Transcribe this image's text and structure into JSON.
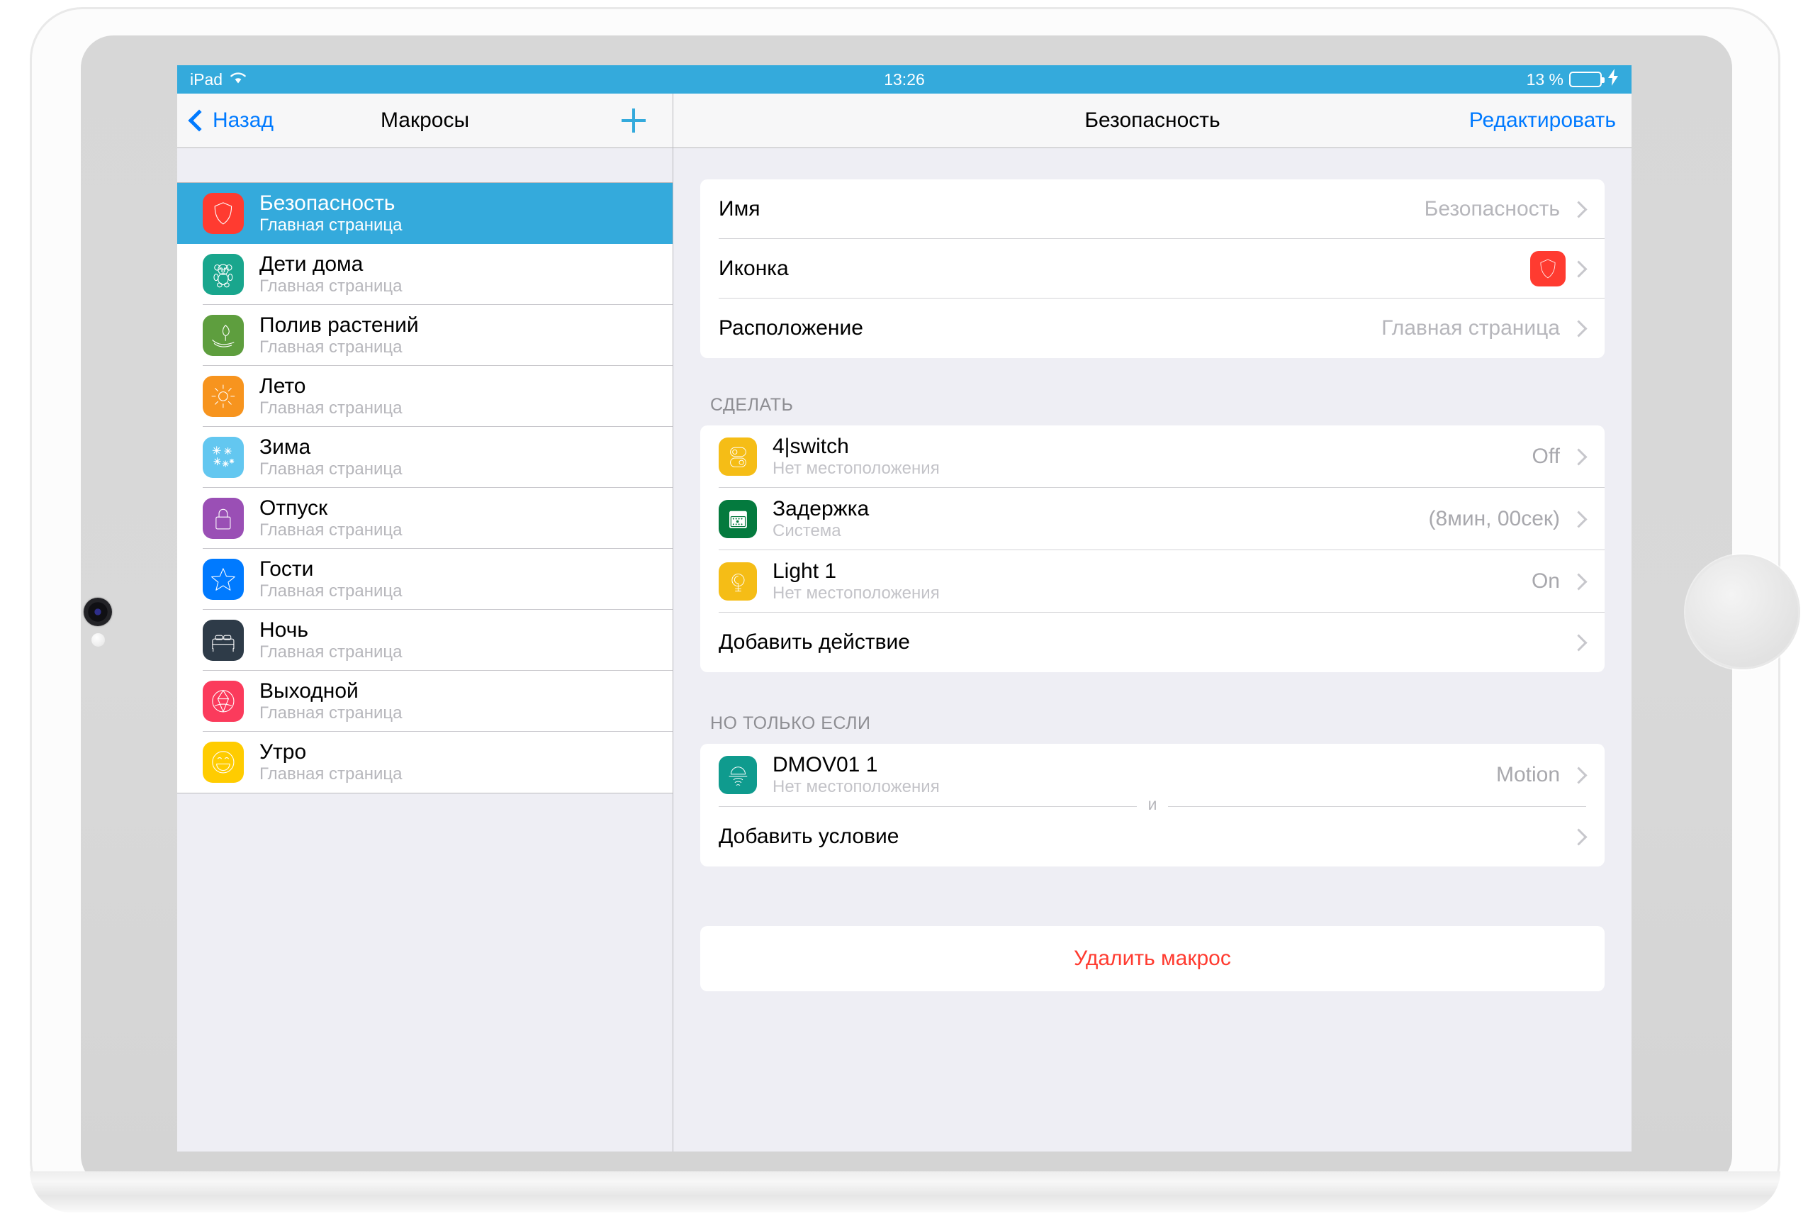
{
  "status_bar": {
    "device": "iPad",
    "wifi_icon": "wifi-icon",
    "time": "13:26",
    "battery_percent": "13 %",
    "charging_icon": "lightning-bolt-icon",
    "battery_level": 13
  },
  "left_nav": {
    "back_label": "Назад",
    "title": "Макросы",
    "add_icon": "plus-icon"
  },
  "right_nav": {
    "title": "Безопасность",
    "edit_label": "Редактировать"
  },
  "sidebar": {
    "items": [
      {
        "title": "Безопасность",
        "subtitle": "Главная страница",
        "icon": "shield-icon",
        "color": "#ff3b30",
        "selected": true
      },
      {
        "title": "Дети дома",
        "subtitle": "Главная страница",
        "icon": "teddy-bear-icon",
        "color": "#19a68d",
        "selected": false
      },
      {
        "title": "Полив растений",
        "subtitle": "Главная страница",
        "icon": "plant-watering-icon",
        "color": "#5e9e3e",
        "selected": false
      },
      {
        "title": "Лето",
        "subtitle": "Главная страница",
        "icon": "sun-icon",
        "color": "#f7941e",
        "selected": false
      },
      {
        "title": "Зима",
        "subtitle": "Главная страница",
        "icon": "snowflakes-icon",
        "color": "#63c7f0",
        "selected": false
      },
      {
        "title": "Отпуск",
        "subtitle": "Главная страница",
        "icon": "padlock-icon",
        "color": "#9a4fb5",
        "selected": false
      },
      {
        "title": "Гости",
        "subtitle": "Главная страница",
        "icon": "star-icon",
        "color": "#007aff",
        "selected": false
      },
      {
        "title": "Ночь",
        "subtitle": "Главная страница",
        "icon": "bed-icon",
        "color": "#2e3b48",
        "selected": false
      },
      {
        "title": "Выходной",
        "subtitle": "Главная страница",
        "icon": "balloon-icon",
        "color": "#fb3b5c",
        "selected": false
      },
      {
        "title": "Утро",
        "subtitle": "Главная страница",
        "icon": "smiley-face-icon",
        "color": "#ffcc00",
        "selected": false
      }
    ]
  },
  "detail": {
    "settings": [
      {
        "label": "Имя",
        "value": "Безопасность",
        "type": "text"
      },
      {
        "label": "Иконка",
        "value": "",
        "type": "icon",
        "icon": "shield-icon",
        "color": "#ff3b30"
      },
      {
        "label": "Расположение",
        "value": "Главная страница",
        "type": "text"
      }
    ],
    "actions_section": {
      "header": "СДЕЛАТЬ",
      "items": [
        {
          "title": "4|switch",
          "subtitle": "Нет местоположения",
          "value": "Off",
          "icon": "switch-toggle-icon",
          "color": "#f5bd16"
        },
        {
          "title": "Задержка",
          "subtitle": "Система",
          "value": "(8мин, 00сек)",
          "icon": "delay-keypad-icon",
          "color": "#047a3e"
        },
        {
          "title": "Light 1",
          "subtitle": "Нет местоположения",
          "value": "On",
          "icon": "lightbulb-icon",
          "color": "#f5bd16"
        }
      ],
      "add_label": "Добавить действие"
    },
    "conditions_section": {
      "header": "НО ТОЛЬКО ЕСЛИ",
      "items": [
        {
          "title": "DMOV01 1",
          "subtitle": "Нет местоположения",
          "value": "Motion",
          "icon": "motion-sensor-icon",
          "color": "#0f9b8e"
        }
      ],
      "conjunction": "и",
      "add_label": "Добавить условие"
    },
    "delete_label": "Удалить макрос"
  }
}
